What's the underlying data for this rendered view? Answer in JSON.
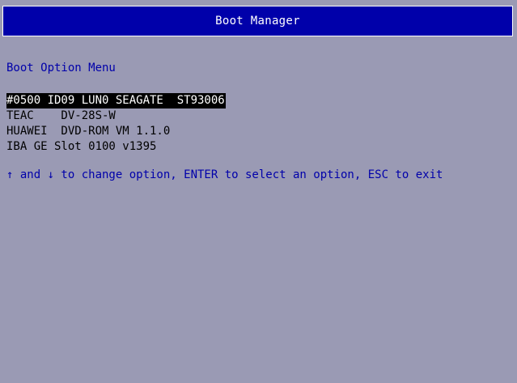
{
  "title": "Boot Manager",
  "menu_heading": "Boot Option Menu",
  "boot_options": [
    {
      "label": "#0500 ID09 LUN0 SEAGATE  ST93006",
      "selected": true
    },
    {
      "label": "TEAC    DV-28S-W",
      "selected": false
    },
    {
      "label": "HUAWEI  DVD-ROM VM 1.1.0",
      "selected": false
    },
    {
      "label": "IBA GE Slot 0100 v1395",
      "selected": false
    }
  ],
  "help_text": "↑ and ↓ to change option, ENTER to select an option, ESC to exit",
  "colors": {
    "background": "#9a9ab4",
    "title_bar": "#0000aa",
    "heading_text": "#0000aa",
    "selected_bg": "#000000",
    "selected_fg": "#ffffff"
  }
}
